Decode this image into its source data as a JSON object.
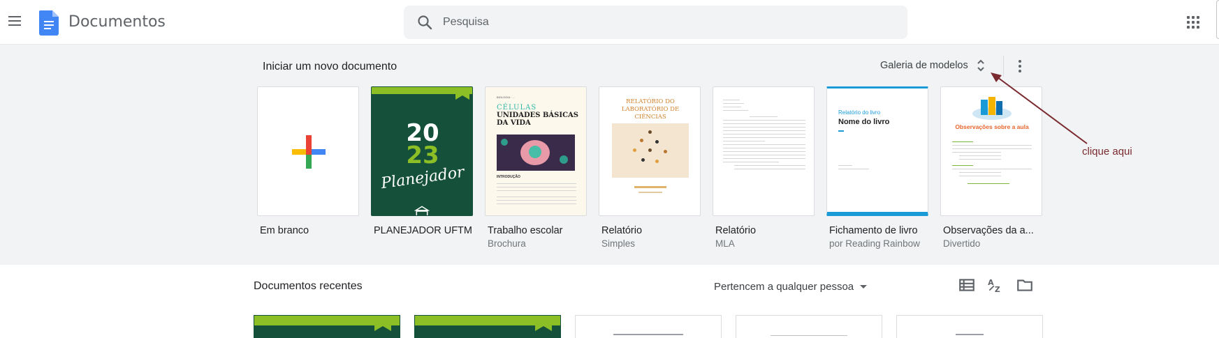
{
  "header": {
    "app_title": "Documentos",
    "search_placeholder": "Pesquisa",
    "icons": [
      "menu-icon",
      "docs-logo-icon",
      "search-icon",
      "apps-grid-icon"
    ]
  },
  "templates_section": {
    "title": "Iniciar um novo documento",
    "gallery_label": "Galeria de modelos",
    "items": [
      {
        "name": "Em branco",
        "subtitle": ""
      },
      {
        "name": "PLANEJADOR UFTM",
        "subtitle": "",
        "thumb_year_top": "20",
        "thumb_year_bottom": "23",
        "thumb_script": "Planejador"
      },
      {
        "name": "Trabalho escolar",
        "subtitle": "Brochura",
        "thumb_kicker": "BIOLOGIA · ...",
        "thumb_title_1": "CÉLULAS",
        "thumb_title_2": "UNIDADES BÁSICAS DA VIDA",
        "thumb_section": "INTRODUÇÃO"
      },
      {
        "name": "Relatório",
        "subtitle": "Simples",
        "thumb_title": "RELATÓRIO DO LABORATÓRIO DE CIÊNCIAS"
      },
      {
        "name": "Relatório",
        "subtitle": "MLA"
      },
      {
        "name": "Fichamento de livro",
        "subtitle": "por Reading Rainbow",
        "thumb_label": "Relatório do livro",
        "thumb_title": "Nome do livro"
      },
      {
        "name": "Observações da a...",
        "subtitle": "Divertido",
        "thumb_title": "Observações sobre a aula"
      }
    ]
  },
  "annotation": {
    "text": "clique aqui",
    "color": "#7b2a30"
  },
  "recent_section": {
    "title": "Documentos recentes",
    "owner_filter": "Pertencem a qualquer pessoa",
    "view_icons": [
      "list-view-icon",
      "sort-az-icon",
      "folder-icon"
    ]
  },
  "colors": {
    "planner_green": "#14503a",
    "planner_lime": "#8cbf26",
    "docs_blue": "#4285f4",
    "book_blue": "#1a9bd7"
  }
}
